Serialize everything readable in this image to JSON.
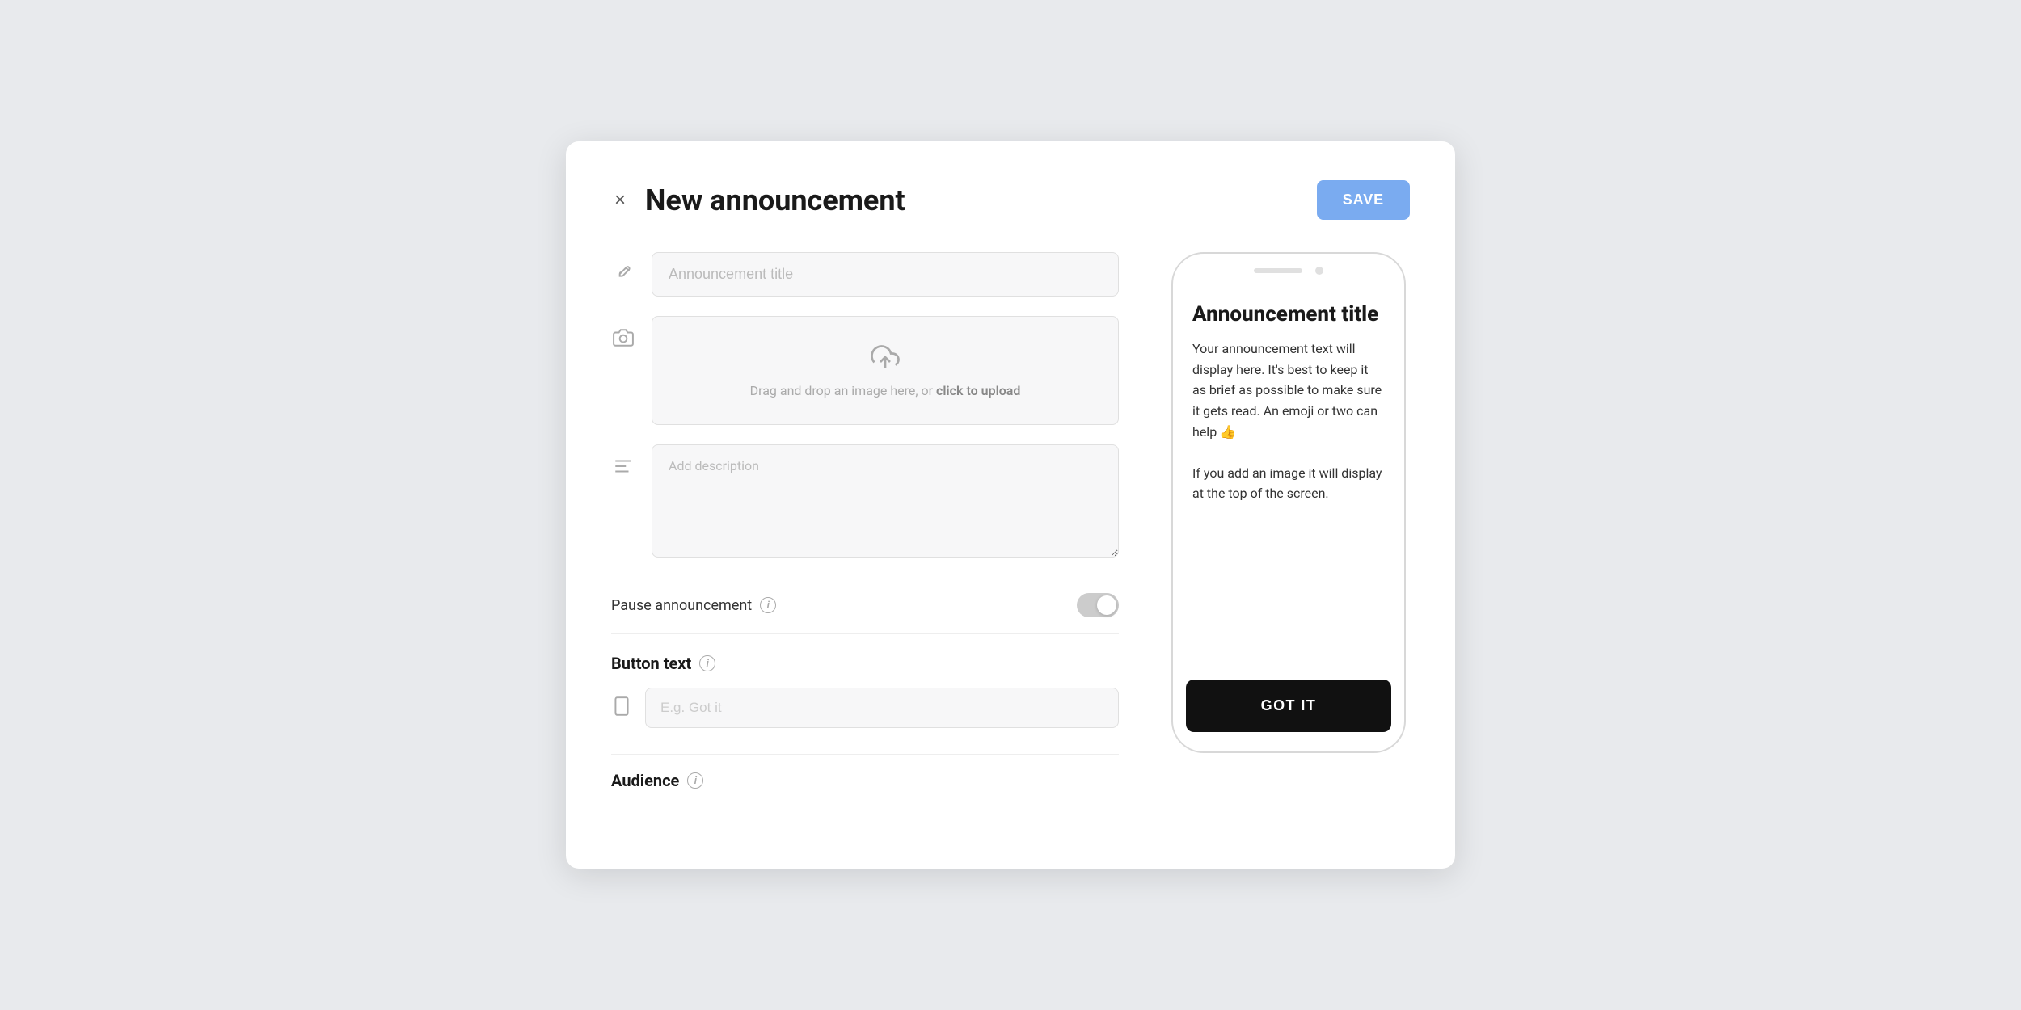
{
  "modal": {
    "title": "New announcement",
    "close_icon": "×",
    "save_label": "SAVE"
  },
  "form": {
    "title_placeholder": "Announcement title",
    "image_upload_text": "Drag and drop an image here, or ",
    "image_upload_link": "click to upload",
    "description_placeholder": "Add description",
    "pause_label": "Pause announcement",
    "button_text_section": "Button text",
    "button_text_placeholder": "E.g. Got it",
    "audience_section": "Audience",
    "info_icon": "i"
  },
  "preview": {
    "title": "Announcement title",
    "body_text": "Your announcement text will display here. It's best to keep it as brief as possible to make sure it gets read. An emoji or two can help 👍\n\nIf you add an image it will display at the top of the screen.",
    "button_label": "GOT IT"
  },
  "icons": {
    "close": "×",
    "pencil": "pencil-icon",
    "camera": "camera-icon",
    "align_left": "align-left-icon",
    "phone": "phone-icon",
    "upload": "upload-icon"
  }
}
